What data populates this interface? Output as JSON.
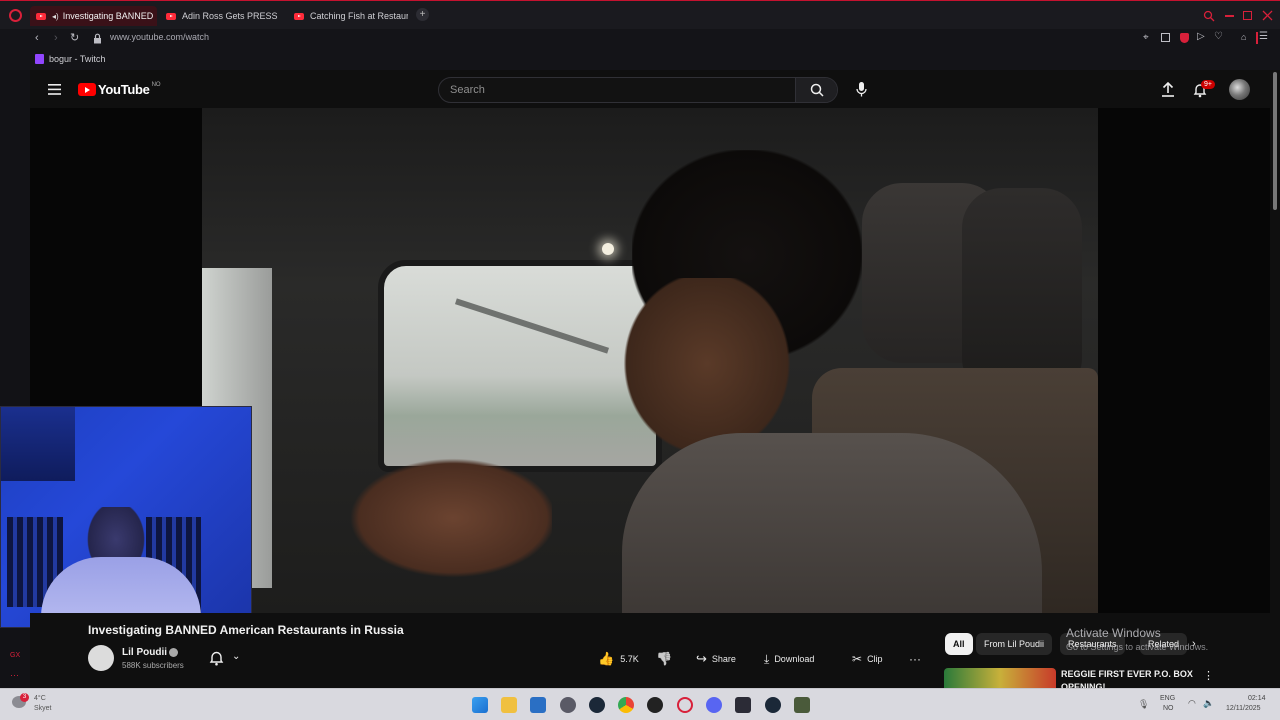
{
  "browser": {
    "tabs": [
      {
        "label": "Investigating BANNED"
      },
      {
        "label": "Adin Ross Gets PRESSED"
      },
      {
        "label": "Catching Fish at Restaura"
      }
    ],
    "new_tab": "+",
    "url": "www.youtube.com/watch",
    "bookmarks": [
      {
        "label": "bogur - Twitch"
      }
    ],
    "left_sidebar_label": "GX"
  },
  "youtube": {
    "logo_text": "YouTube",
    "country_code": "NO",
    "search_placeholder": "Search",
    "notification_badge": "9+",
    "video_title": "Investigating BANNED American Restaurants in Russia",
    "channel": {
      "name": "Lil Poudii",
      "subscribers": "588K subscribers"
    },
    "actions": {
      "likes": "5.7K",
      "share": "Share",
      "download": "Download",
      "clip": "Clip"
    },
    "chips": [
      "All",
      "From Lil Poudii",
      "Restaurants",
      "Related"
    ],
    "recommendation": {
      "title_line1": "REGGIE FIRST EVER P.O. BOX",
      "title_line2": "OPENING!"
    }
  },
  "windows": {
    "activate_title": "Activate Windows",
    "activate_sub": "Go to Settings to activate Windows.",
    "weather_temp": "4°C",
    "weather_desc": "Skyet",
    "weather_badge": "3",
    "lang_line1": "ENG",
    "lang_line2": "NO",
    "time": "02:14",
    "date": "12/11/2025"
  },
  "colors": {
    "accent": "#c4122f",
    "youtube_red": "#ff0000",
    "page_bg": "#0f0f0f"
  }
}
